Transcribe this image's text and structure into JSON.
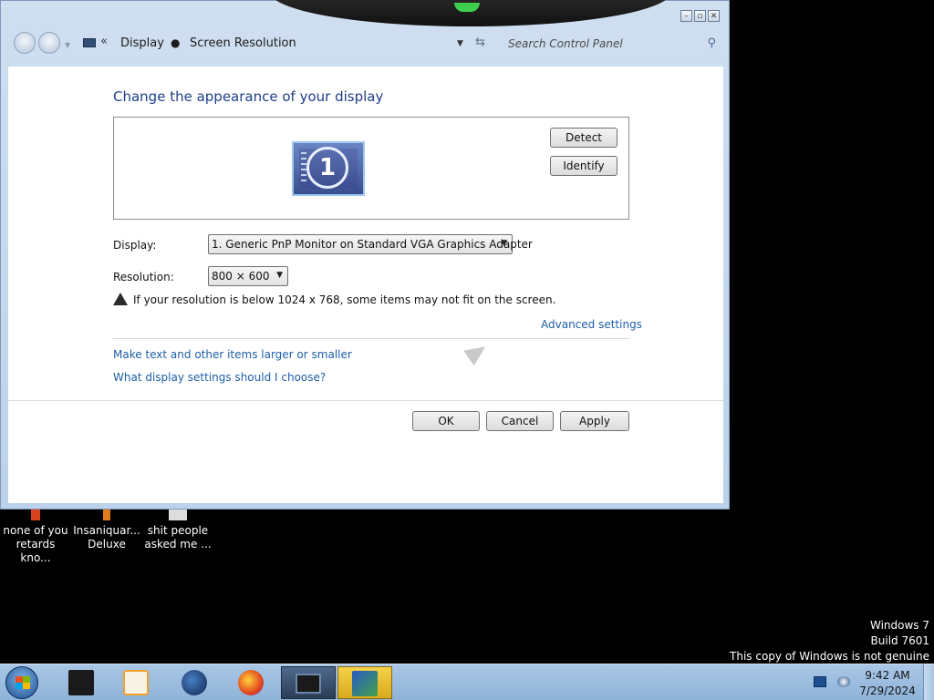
{
  "window": {
    "caption_buttons": [
      "minimize-icon",
      "restore-icon",
      "close-icon"
    ]
  },
  "addressbar": {
    "crumb_chevron": "«",
    "crumbs": [
      "Display",
      "Screen Resolution"
    ],
    "search_placeholder": "Search Control Panel"
  },
  "main": {
    "title": "Change the appearance of your display",
    "monitor_number": "1",
    "detect_label": "Detect",
    "identify_label": "Identify",
    "display_label": "Display:",
    "display_value": "1. Generic PnP Monitor on Standard VGA Graphics Adapter",
    "resolution_label": "Resolution:",
    "resolution_value": "800 × 600",
    "warning_text": "If your resolution is below 1024 x 768, some items may not fit on the screen.",
    "advanced_link": "Advanced settings",
    "larger_link": "Make text and other items larger or smaller",
    "choose_link": "What display settings should I choose?"
  },
  "footer": {
    "ok_label": "OK",
    "cancel_label": "Cancel",
    "apply_label": "Apply"
  },
  "desktop": {
    "icons": [
      {
        "line1": "none of you",
        "line2": "retards kno..."
      },
      {
        "line1": "Insaniquar...",
        "line2": "Deluxe"
      },
      {
        "line1": "shit people",
        "line2": "asked me ..."
      }
    ],
    "watermark": [
      "Windows 7",
      "Build 7601",
      "This copy of Windows is not genuine"
    ]
  },
  "taskbar": {
    "time": "9:42 AM",
    "date": "7/29/2024"
  },
  "colors": {
    "link": "#1e5fa8",
    "title": "#1e3e8a",
    "desktop": "#000000",
    "taskbar": "#a9c7e6"
  }
}
